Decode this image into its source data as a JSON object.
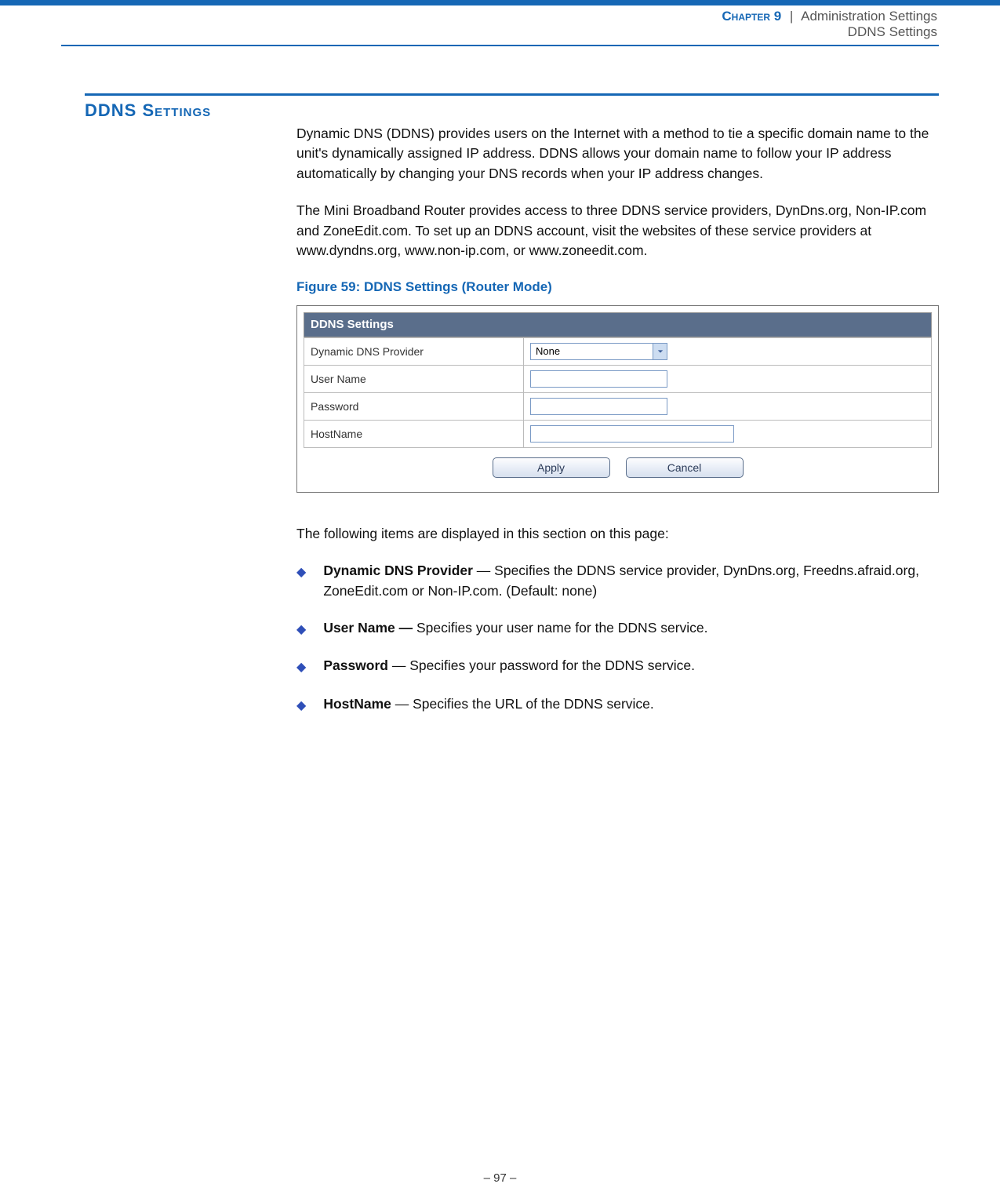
{
  "header": {
    "chapter_label": "Chapter 9",
    "pipe": "|",
    "chapter_title": "Administration Settings",
    "subtitle": "DDNS Settings"
  },
  "section": {
    "heading": "DDNS Settings"
  },
  "paragraphs": {
    "p1": "Dynamic DNS (DDNS) provides users on the Internet with a method to tie a specific domain name to the unit's dynamically assigned IP address. DDNS allows your domain name to follow your IP address automatically by changing your DNS records when your IP address changes.",
    "p2": "The Mini Broadband Router provides access to three DDNS service providers, DynDns.org, Non-IP.com and ZoneEdit.com. To set up an DDNS account, visit the websites of these service providers at www.dyndns.org, www.non-ip.com, or www.zoneedit.com."
  },
  "figure": {
    "caption": "Figure 59:  DDNS Settings (Router Mode)",
    "panel_title": "DDNS Settings",
    "rows": {
      "provider_label": "Dynamic DNS Provider",
      "provider_value": "None",
      "username_label": "User Name",
      "password_label": "Password",
      "hostname_label": "HostName"
    },
    "buttons": {
      "apply": "Apply",
      "cancel": "Cancel"
    }
  },
  "list_intro": "The following items are displayed in this section on this page:",
  "items": [
    {
      "term": "Dynamic DNS Provider",
      "sep": " — ",
      "desc": "Specifies the DDNS service provider, DynDns.org, Freedns.afraid.org, ZoneEdit.com or Non-IP.com. (Default: none)"
    },
    {
      "term": "User Name — ",
      "sep": "",
      "desc": "Specifies your user name for the DDNS service."
    },
    {
      "term": "Password",
      "sep": " — ",
      "desc": "Specifies your password for the DDNS service."
    },
    {
      "term": "HostName",
      "sep": " — ",
      "desc": "Specifies the URL of the DDNS service."
    }
  ],
  "footer": {
    "page": "–  97  –"
  }
}
